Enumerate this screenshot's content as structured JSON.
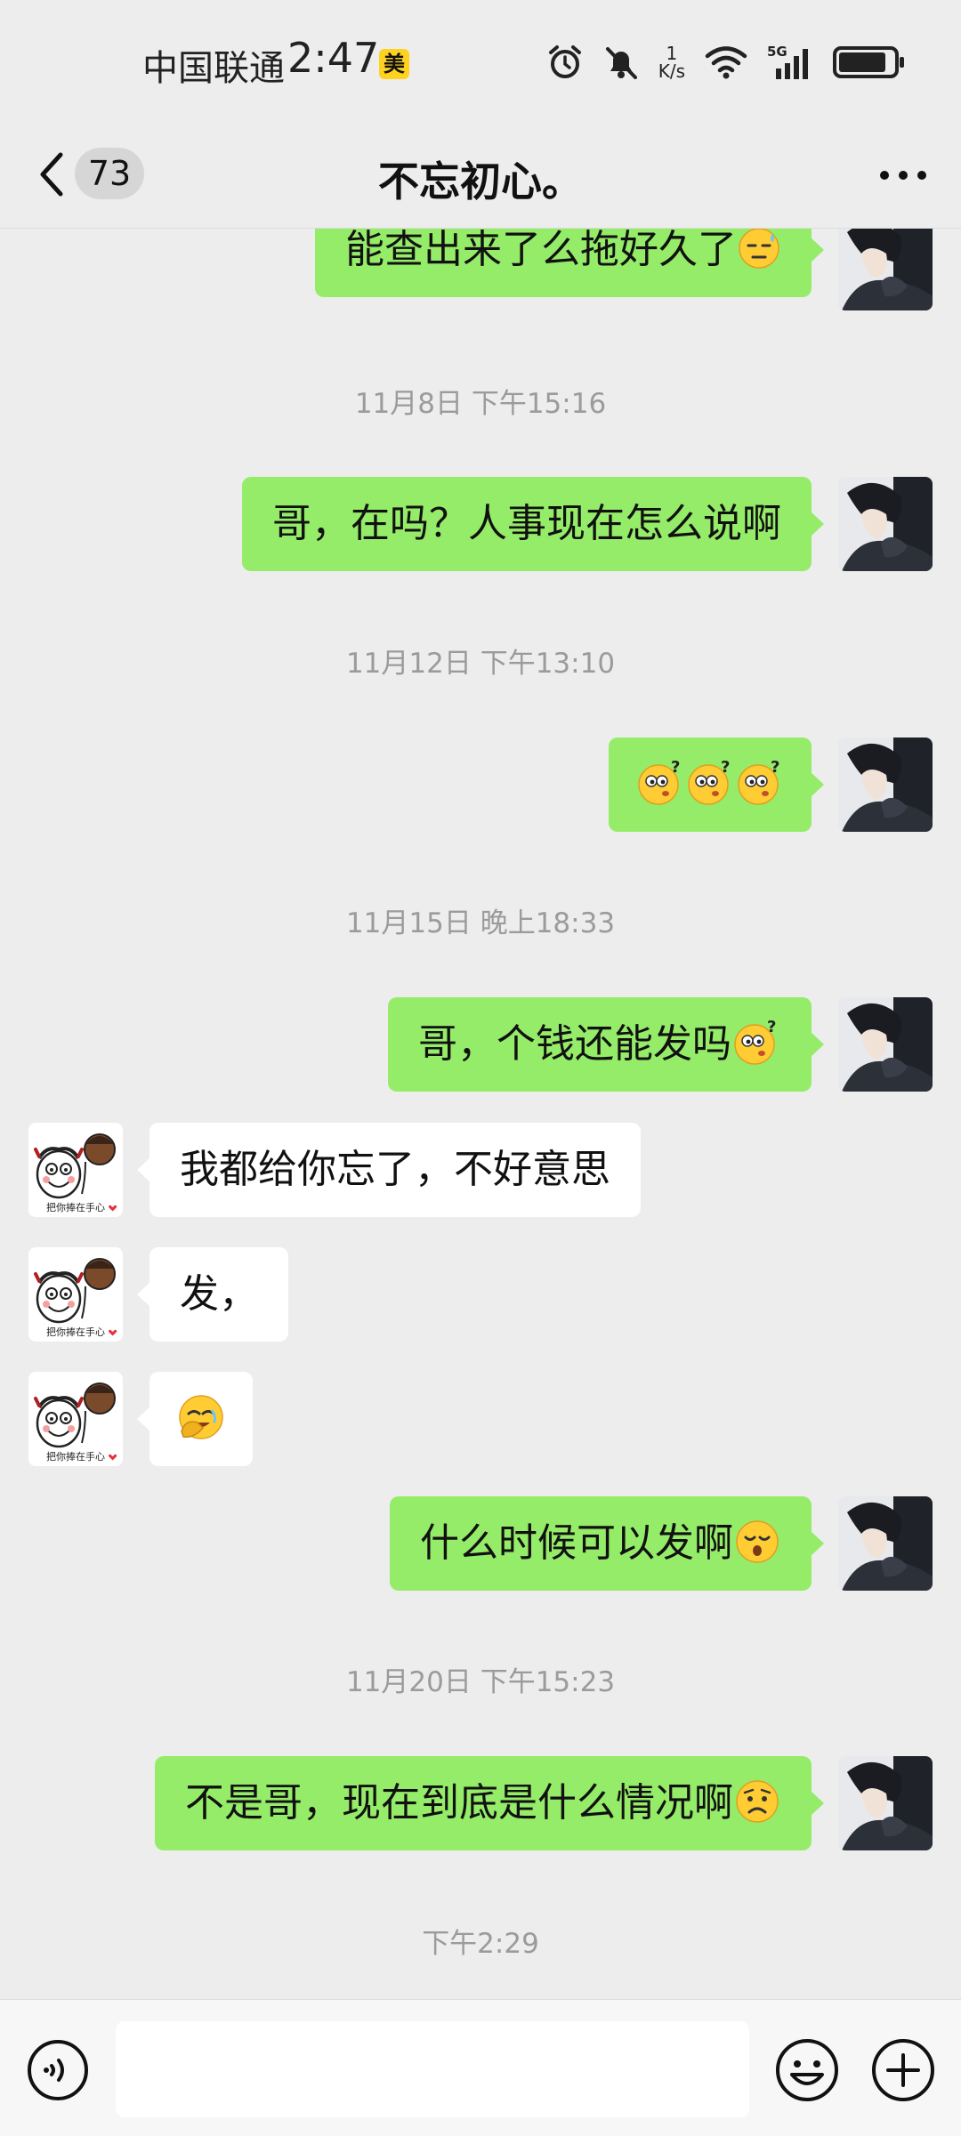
{
  "status_bar": {
    "carrier": "中国联通",
    "time": "2:47",
    "app_badge": "美",
    "net_speed_value": "1",
    "net_speed_unit": "K/s",
    "network": "5G"
  },
  "nav": {
    "unread_count": "73",
    "title": "不忘初心。"
  },
  "messages": [
    {
      "text": "能查出来了么拖好久了",
      "emoji": "sweat-face"
    },
    {
      "timestamp": "11月8日 下午15:16"
    },
    {
      "text": "哥，在吗？人事现在怎么说啊"
    },
    {
      "timestamp": "11月12日 下午13:10"
    },
    {
      "text": "",
      "emoji": "confused-face x3"
    },
    {
      "timestamp": "11月15日 晚上18:33"
    },
    {
      "text": "哥，个钱还能发吗",
      "emoji": "confused-face"
    },
    {
      "text": "我都给你忘了，不好意思",
      "sticker_caption": "把你捧在手心"
    },
    {
      "text": "发，",
      "sticker_caption": "把你捧在手心"
    },
    {
      "text": "",
      "emoji": "facepalm-laugh",
      "sticker_caption": "把你捧在手心"
    },
    {
      "text": "什么时候可以发啊",
      "emoji": "sleepy-face"
    },
    {
      "timestamp": "11月20日 下午15:23"
    },
    {
      "text": "不是哥，现在到底是什么情况啊",
      "emoji": "worried-face"
    },
    {
      "timestamp": "下午2:29"
    }
  ],
  "colors": {
    "background": "#ededed",
    "my_bubble": "#95ec69",
    "their_bubble": "#ffffff",
    "timestamp": "#9b9b9b"
  }
}
